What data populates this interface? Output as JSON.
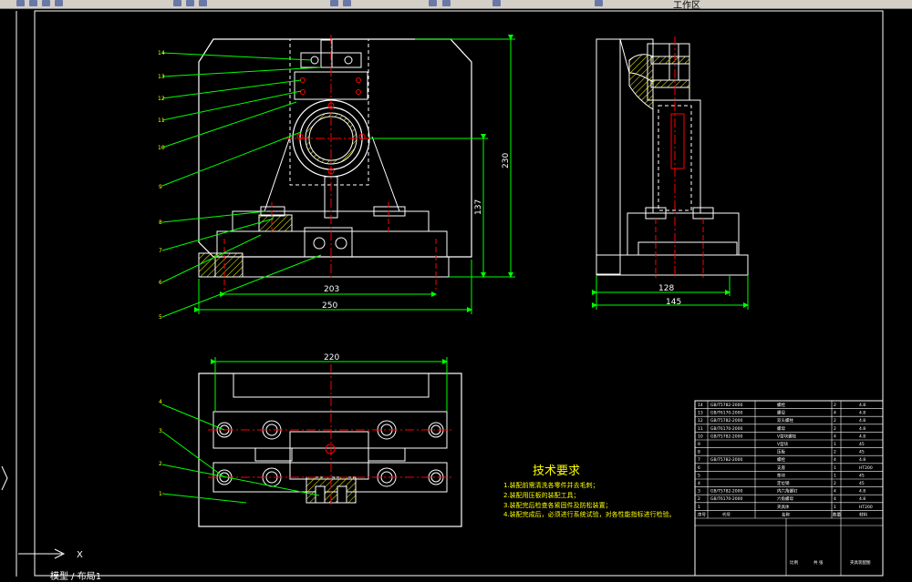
{
  "toolbar": {
    "title_fragment": "工作区"
  },
  "front_view": {
    "dims": {
      "width_inner": "203",
      "width_outer": "250",
      "height_total": "230",
      "height_center": "137"
    },
    "balloons": [
      "14",
      "13",
      "12",
      "11",
      "10",
      "9",
      "8",
      "7",
      "6",
      "5"
    ]
  },
  "side_view": {
    "dims": {
      "width_inner": "128",
      "width_outer": "145"
    }
  },
  "top_view": {
    "dims": {
      "width": "220"
    },
    "balloons": [
      "4",
      "3",
      "2",
      "1"
    ]
  },
  "tech_notes": {
    "title": "技术要求",
    "items": [
      "1.装配前需清洗各零件并去毛刺；",
      "2.装配用压板的装配工具；",
      "3.装配完后检查各紧固件及防松装置；",
      "4.装配完成后，必须进行系统试验，对各性能指标进行检验。"
    ]
  },
  "bom": {
    "rows": [
      {
        "no": "14",
        "code": "GB/T5782-2000",
        "name": "螺栓",
        "qty": "2",
        "mat": "4.8"
      },
      {
        "no": "13",
        "code": "GB/T6170-2000",
        "name": "螺母",
        "qty": "4",
        "mat": "4.8"
      },
      {
        "no": "12",
        "code": "GB/T5782-2000",
        "name": "双头螺柱",
        "qty": "2",
        "mat": "4.8"
      },
      {
        "no": "11",
        "code": "GB/T6170-2000",
        "name": "螺母",
        "qty": "2",
        "mat": "4.8"
      },
      {
        "no": "10",
        "code": "GB/T5782-2000",
        "name": "V型块螺栓",
        "qty": "4",
        "mat": "4.8"
      },
      {
        "no": "9",
        "code": "",
        "name": "V型块",
        "qty": "1",
        "mat": "45"
      },
      {
        "no": "8",
        "code": "",
        "name": "压板",
        "qty": "2",
        "mat": "45"
      },
      {
        "no": "7",
        "code": "GB/T5782-2000",
        "name": "螺栓",
        "qty": "4",
        "mat": "4.8"
      },
      {
        "no": "6",
        "code": "",
        "name": "支座",
        "qty": "1",
        "mat": "HT200"
      },
      {
        "no": "5",
        "code": "",
        "name": "垫块",
        "qty": "1",
        "mat": "45"
      },
      {
        "no": "4",
        "code": "",
        "name": "定位销",
        "qty": "2",
        "mat": "45"
      },
      {
        "no": "3",
        "code": "GB/T5782-2000",
        "name": "内六角螺钉",
        "qty": "4",
        "mat": "4.8"
      },
      {
        "no": "2",
        "code": "GB/T6170-2000",
        "name": "六角螺母",
        "qty": "4",
        "mat": "4.8"
      },
      {
        "no": "1",
        "code": "",
        "name": "夹具体",
        "qty": "1",
        "mat": "HT200"
      }
    ],
    "header": [
      "序号",
      "代号",
      "名称",
      "数量",
      "材料"
    ],
    "title_block": {
      "drawing_title": "夹具装配图",
      "scale_label": "比例",
      "sheet_label": "共 张"
    }
  },
  "cmdline": {
    "text": "模型 / 布局1"
  }
}
